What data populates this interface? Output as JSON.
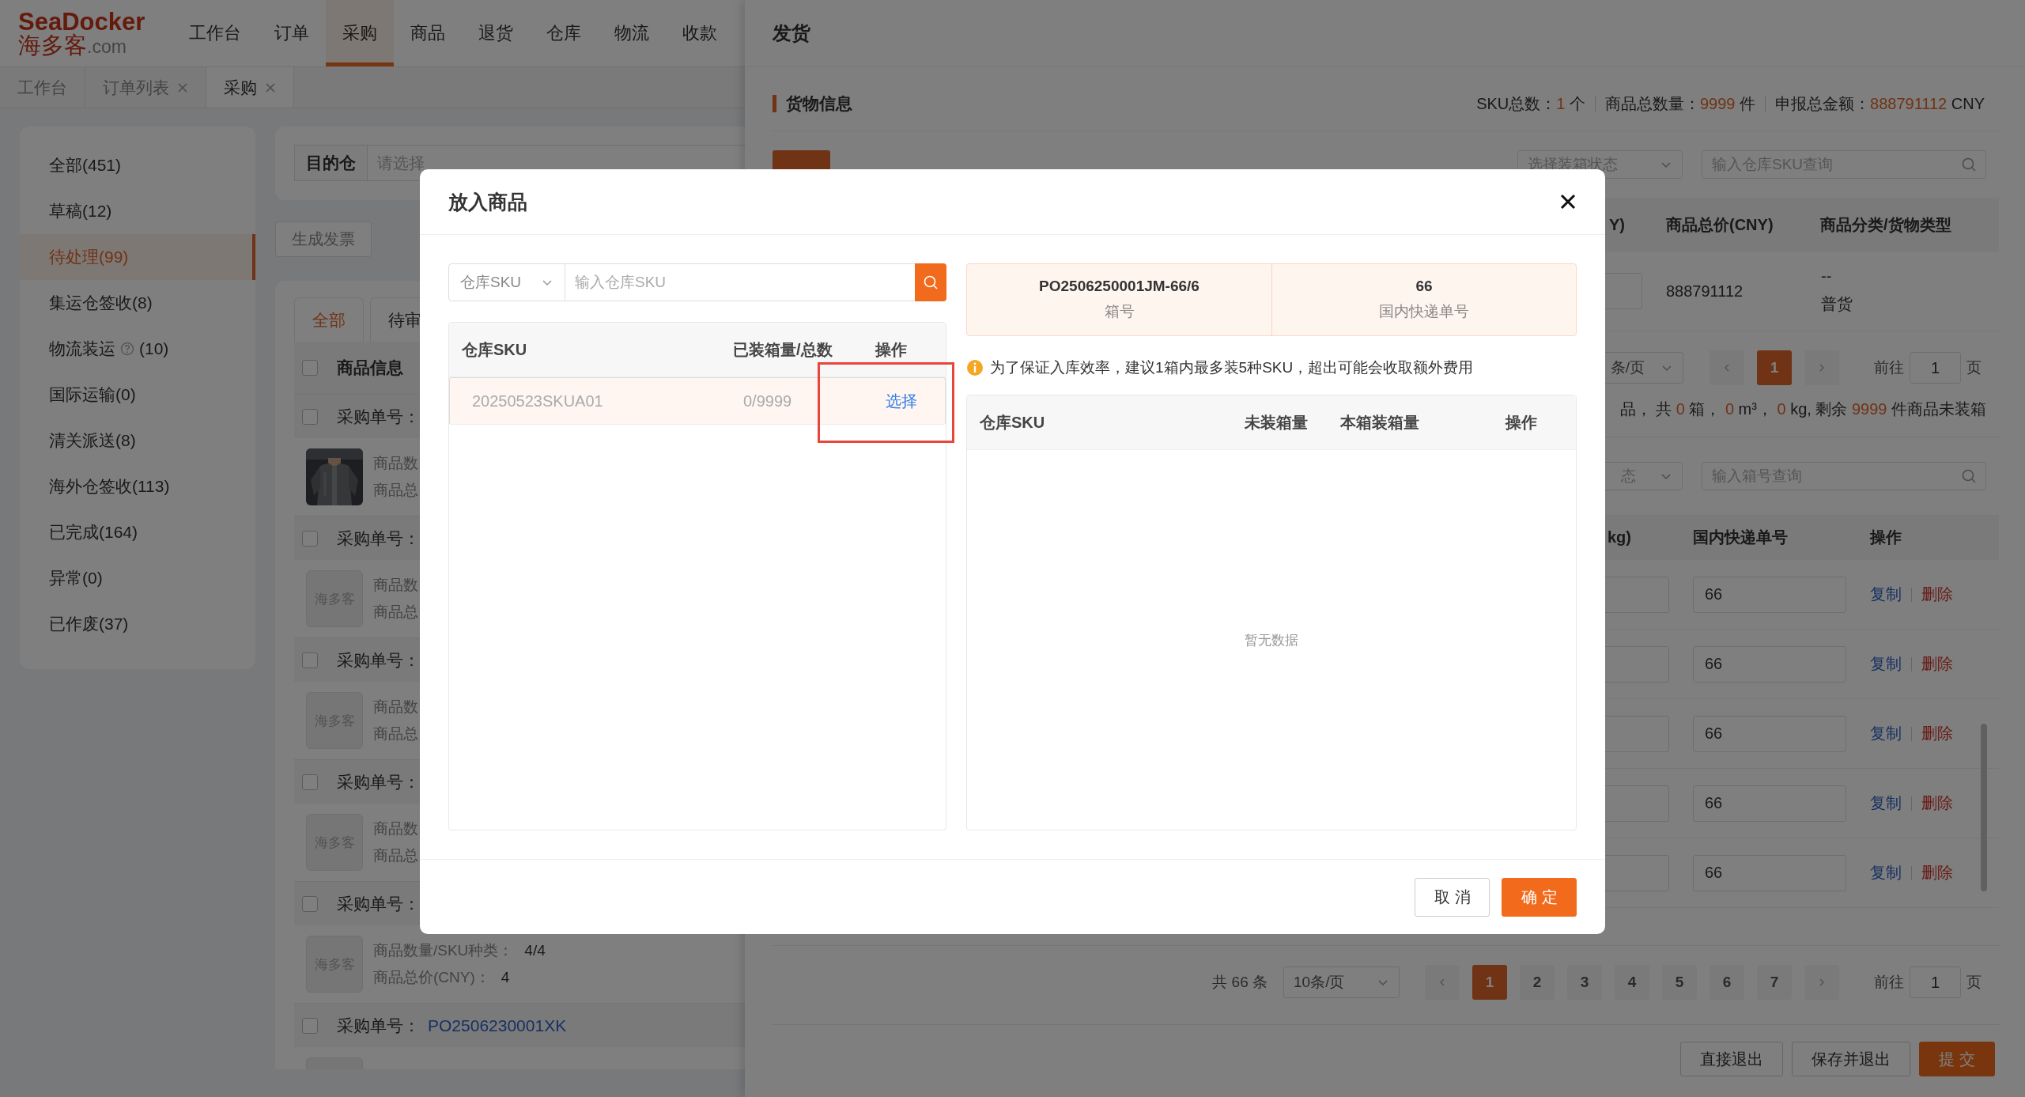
{
  "header": {
    "logo": {
      "brand": "SeaDocker",
      "name": "海多客",
      "domain": ".com"
    },
    "nav": [
      {
        "label": "工作台",
        "selected": false
      },
      {
        "label": "订单",
        "selected": false
      },
      {
        "label": "采购",
        "selected": true
      },
      {
        "label": "商品",
        "selected": false
      },
      {
        "label": "退货",
        "selected": false
      },
      {
        "label": "仓库",
        "selected": false
      },
      {
        "label": "物流",
        "selected": false
      },
      {
        "label": "收款",
        "selected": false
      }
    ]
  },
  "page_tabs": [
    {
      "label": "工作台",
      "closable": false,
      "selected": false
    },
    {
      "label": "订单列表",
      "closable": true,
      "selected": false
    },
    {
      "label": "采购",
      "closable": true,
      "selected": true
    }
  ],
  "sidebar": {
    "items": [
      {
        "label": "全部(451)",
        "help": false,
        "selected": false
      },
      {
        "label": "草稿(12)",
        "help": false,
        "selected": false
      },
      {
        "label": "待处理(99)",
        "help": false,
        "selected": true
      },
      {
        "label": "集运仓签收(8)",
        "help": false,
        "selected": false
      },
      {
        "label": "物流装运",
        "count": "(10)",
        "help": true,
        "selected": false
      },
      {
        "label": "国际运输(0)",
        "help": false,
        "selected": false
      },
      {
        "label": "清关派送(8)",
        "help": false,
        "selected": false
      },
      {
        "label": "海外仓签收(113)",
        "help": false,
        "selected": false
      },
      {
        "label": "已完成(164)",
        "help": false,
        "selected": false
      },
      {
        "label": "异常(0)",
        "help": false,
        "selected": false
      },
      {
        "label": "已作废(37)",
        "help": false,
        "selected": false
      }
    ]
  },
  "filter": {
    "label": "目的仓",
    "placeholder": "请选择"
  },
  "toolbar_buttons": [
    "生成发票"
  ],
  "status_tabs": [
    {
      "label": "全部",
      "selected": true
    },
    {
      "label": "待审",
      "selected": false
    }
  ],
  "orders": {
    "header": "商品信息",
    "header_checked": false,
    "items": [
      {
        "order_label": "采购单号：",
        "checked": false,
        "lines": [
          {
            "label": "商品数"
          },
          {
            "label": "商品总"
          }
        ]
      },
      {
        "order_label": "采购单号：",
        "checked": false,
        "kind": "placeholder",
        "thumb_text": "海多客",
        "lines": [
          {
            "label": "商品数"
          },
          {
            "label": "商品总"
          }
        ]
      },
      {
        "order_label": "采购单号：",
        "checked": false,
        "kind": "placeholder",
        "thumb_text": "海多客",
        "lines": [
          {
            "label": "商品数"
          },
          {
            "label": "商品总"
          }
        ]
      },
      {
        "order_label": "采购单号：",
        "checked": false,
        "kind": "placeholder",
        "thumb_text": "海多客",
        "lines": [
          {
            "label": "商品数"
          },
          {
            "label": "商品总"
          }
        ]
      },
      {
        "order_label": "采购单号：",
        "checked": false,
        "kind": "placeholder",
        "thumb_text": "海多客",
        "lines": [
          {
            "label": "商品数量/SKU种类：",
            "value": "4/4"
          },
          {
            "label": "商品总价(CNY)：",
            "value": "4"
          }
        ]
      },
      {
        "order_label": "采购单号：",
        "order_no": "PO2506230001XK",
        "checked": false,
        "kind": "placeholder"
      }
    ]
  },
  "drawer": {
    "title": "发货",
    "section_title": "货物信息",
    "totals": [
      {
        "label": "SKU总数：",
        "value": "1",
        "unit": "个"
      },
      {
        "label": "商品总数量：",
        "value": "9999",
        "unit": "件"
      },
      {
        "label": "申报总金额：",
        "value": "888791112",
        "unit": "CNY"
      }
    ],
    "status_select": {
      "placeholder": "选择装箱状态"
    },
    "sku_search": {
      "placeholder": "输入仓库SKU查询"
    },
    "sku_table": {
      "columns": [
        "Y)",
        "商品总价(CNY)",
        "商品分类/货物类型"
      ],
      "rows": [
        {
          "total_price": "888791112",
          "category": "--",
          "cargo_type": "普货"
        }
      ]
    },
    "pager": {
      "page_size": "条/页",
      "pages": [
        {
          "label": "1",
          "selected": true
        }
      ],
      "goto_label": "前往",
      "goto_value": "1",
      "page_unit": "页"
    },
    "packing_summary": [
      {
        "text": "品， 共 ",
        "highlight": false
      },
      {
        "text": "0",
        "highlight": true
      },
      {
        "text": " 箱， ",
        "highlight": false
      },
      {
        "text": "0",
        "highlight": true
      },
      {
        "text": " m³， ",
        "highlight": false
      },
      {
        "text": "0",
        "highlight": true
      },
      {
        "text": " kg, 剩余 ",
        "highlight": false
      },
      {
        "text": "9999",
        "highlight": true
      },
      {
        "text": " 件商品未装箱",
        "highlight": false
      }
    ],
    "box_status_select": {
      "placeholder": "态"
    },
    "box_search": {
      "placeholder": "输入箱号查询"
    },
    "box_table": {
      "columns": [
        "kg)",
        "国内快递单号",
        "操作"
      ],
      "rows": [
        {
          "express_no": "66",
          "actions": [
            {
              "label": "复制",
              "kind": "copy"
            },
            {
              "label": "删除",
              "kind": "delete"
            }
          ]
        },
        {
          "express_no": "66",
          "actions": [
            {
              "label": "复制",
              "kind": "copy"
            },
            {
              "label": "删除",
              "kind": "delete"
            }
          ]
        },
        {
          "express_no": "66",
          "actions": [
            {
              "label": "复制",
              "kind": "copy"
            },
            {
              "label": "删除",
              "kind": "delete"
            }
          ]
        },
        {
          "express_no": "66",
          "actions": [
            {
              "label": "复制",
              "kind": "copy"
            },
            {
              "label": "删除",
              "kind": "delete"
            }
          ]
        },
        {
          "express_no": "66",
          "actions": [
            {
              "label": "复制",
              "kind": "copy"
            },
            {
              "label": "删除",
              "kind": "delete"
            }
          ]
        }
      ]
    },
    "pager_bottom": {
      "total": "共 66 条",
      "page_size": "10条/页",
      "pages": [
        {
          "label": "1",
          "selected": true
        },
        {
          "label": "2",
          "selected": false
        },
        {
          "label": "3",
          "selected": false
        },
        {
          "label": "4",
          "selected": false
        },
        {
          "label": "5",
          "selected": false
        },
        {
          "label": "6",
          "selected": false
        },
        {
          "label": "7",
          "selected": false
        }
      ],
      "goto_label": "前往",
      "goto_value": "1",
      "page_unit": "页"
    },
    "footer_buttons": [
      {
        "label": "直接退出",
        "kind": "default"
      },
      {
        "label": "保存并退出",
        "kind": "default"
      },
      {
        "label": "提 交",
        "kind": "primary"
      }
    ]
  },
  "modal": {
    "title": "放入商品",
    "search": {
      "type": "仓库SKU",
      "placeholder": "输入仓库SKU"
    },
    "sku_table": {
      "columns": [
        "仓库SKU",
        "已装箱量/总数",
        "操作"
      ],
      "rows": [
        {
          "sku": "20250523SKUA01",
          "packed": "0/9999",
          "action": "选择",
          "selected": true
        }
      ]
    },
    "box_info": [
      {
        "value": "PO2506250001JM-66/6",
        "label": "箱号"
      },
      {
        "value": "66",
        "label": "国内快递单号"
      }
    ],
    "notice": "为了保证入库效率，建议1箱内最多装5种SKU，超出可能会收取额外费用",
    "box_table": {
      "columns": [
        "仓库SKU",
        "未装箱量",
        "本箱装箱量",
        "操作"
      ],
      "empty_text": "暂无数据"
    },
    "buttons": [
      {
        "label": "取 消",
        "kind": "default"
      },
      {
        "label": "确 定",
        "kind": "primary"
      }
    ]
  }
}
